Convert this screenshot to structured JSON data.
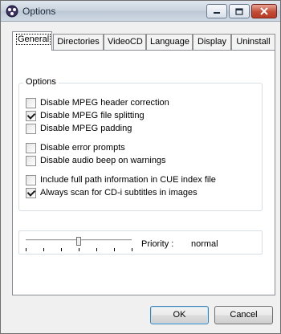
{
  "window": {
    "title": "Options"
  },
  "tabs": [
    {
      "label": "General",
      "active": true
    },
    {
      "label": "Directories",
      "active": false
    },
    {
      "label": "VideoCD",
      "active": false
    },
    {
      "label": "Language",
      "active": false
    },
    {
      "label": "Display",
      "active": false
    },
    {
      "label": "Uninstall",
      "active": false
    }
  ],
  "options_group": {
    "label": "Options",
    "items": [
      {
        "label": "Disable MPEG header correction",
        "checked": false
      },
      {
        "label": "Disable MPEG file splitting",
        "checked": true
      },
      {
        "label": "Disable MPEG padding",
        "checked": false
      },
      {
        "label": "Disable error prompts",
        "checked": false
      },
      {
        "label": "Disable audio beep on warnings",
        "checked": false
      },
      {
        "label": "Include full path information in CUE index file",
        "checked": false
      },
      {
        "label": "Always scan for CD-i subtitles in images",
        "checked": true
      }
    ]
  },
  "priority": {
    "label": "Priority :",
    "value": "normal",
    "level": 0.5,
    "tick_count": 7
  },
  "buttons": {
    "ok": "OK",
    "cancel": "Cancel"
  },
  "colors": {
    "panel_bg": "#ffffff",
    "window_bg": "#f0f0f0",
    "close_button": "#c44b35"
  },
  "icons": [
    "app-disc-icon",
    "minimize-icon",
    "maximize-icon",
    "close-icon",
    "checkmark-icon"
  ]
}
